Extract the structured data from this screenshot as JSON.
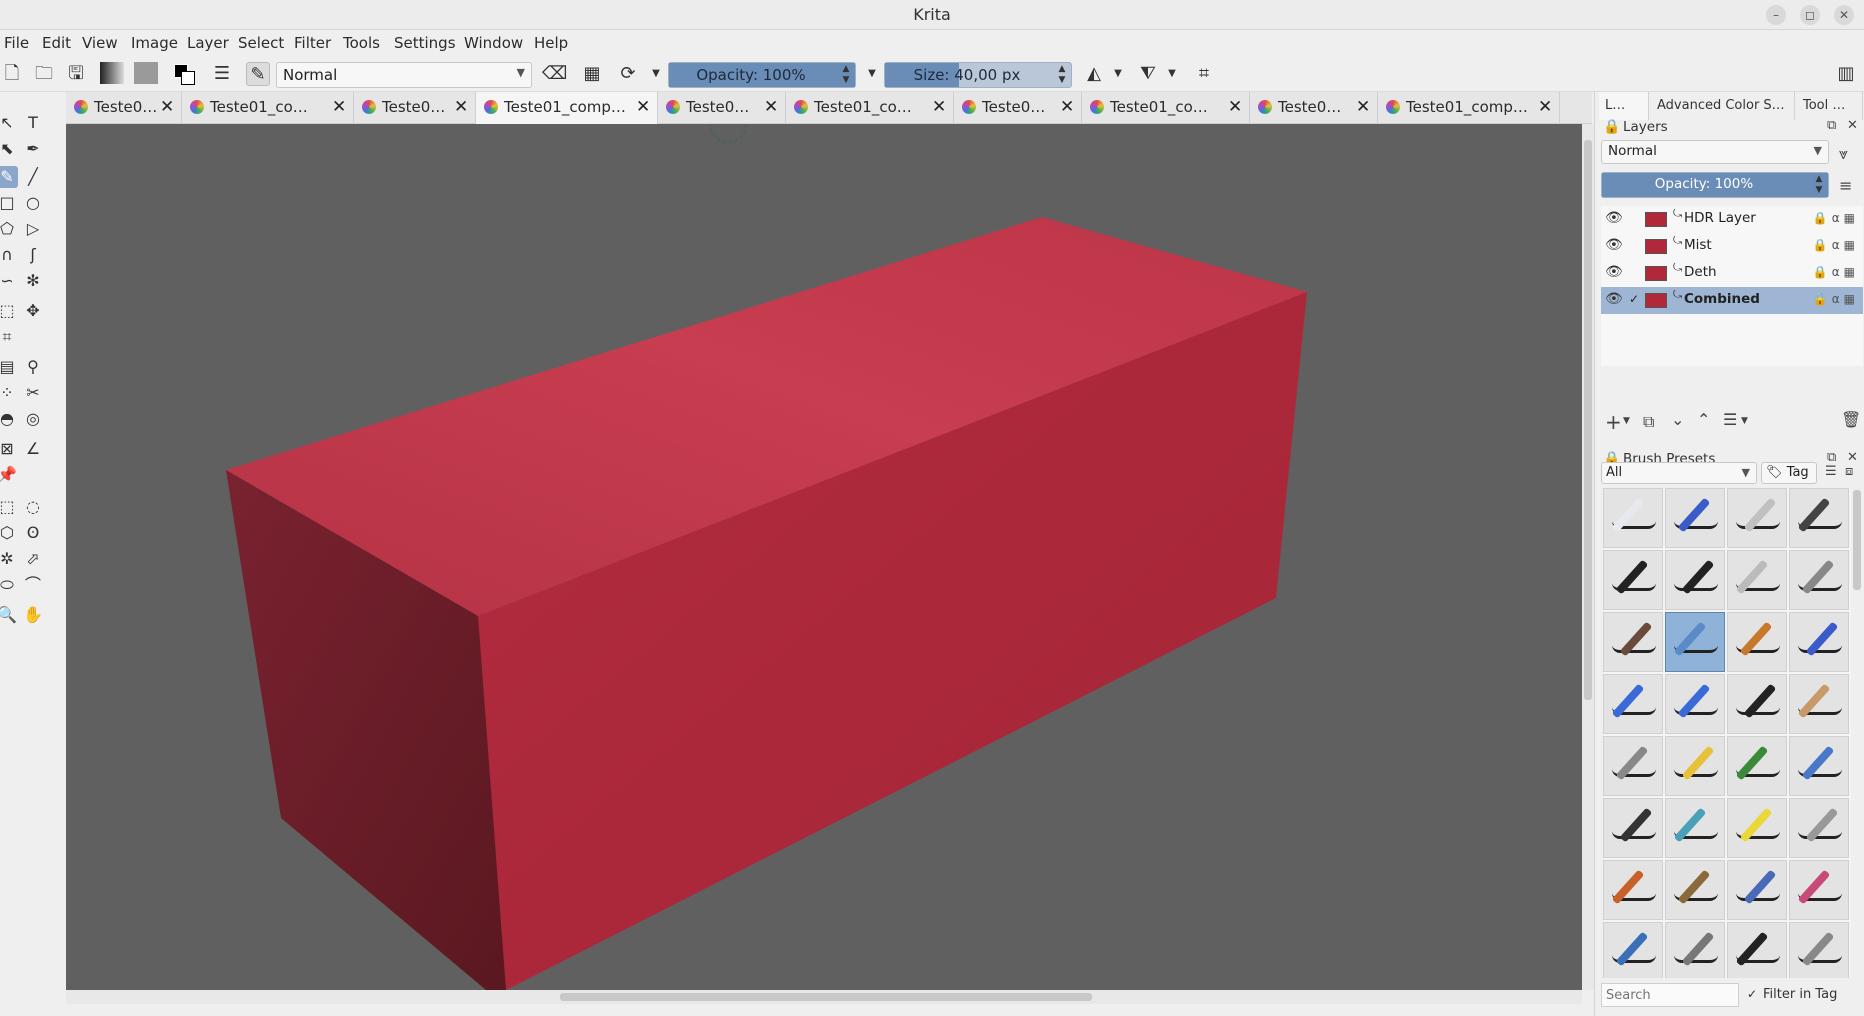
{
  "window": {
    "title": "Krita",
    "minimize": "–",
    "restore": "◻",
    "close": "✕"
  },
  "menu": [
    "File",
    "Edit",
    "View",
    "Image",
    "Layer",
    "Select",
    "Filter",
    "Tools",
    "Settings",
    "Window",
    "Help"
  ],
  "toolbar": {
    "blend_mode": "Normal",
    "opacity_label": "Opacity: 100%",
    "opacity_value": 1.0,
    "size_label": "Size: 40,00 px",
    "size_value": 0.4
  },
  "tabs": [
    {
      "label": "Teste0…",
      "width": 116
    },
    {
      "label": "Teste01_co…",
      "width": 172
    },
    {
      "label": "Teste0…",
      "width": 122
    },
    {
      "label": "Teste01_comp…",
      "width": 182
    },
    {
      "label": "Teste0…",
      "width": 128
    },
    {
      "label": "Teste01_co…",
      "width": 168
    },
    {
      "label": "Teste0…",
      "width": 128
    },
    {
      "label": "Teste01_co…",
      "width": 168
    },
    {
      "label": "Teste0…",
      "width": 128
    },
    {
      "label": "Teste01_comp…",
      "width": 182
    }
  ],
  "active_tab": 3,
  "dock": {
    "tabs": [
      "L…",
      "Advanced Color S…",
      "Tool …"
    ],
    "layers_title": "Layers",
    "layers_blend": "Normal",
    "layers_opacity_label": "Opacity:  100%",
    "layers": [
      {
        "name": "HDR Layer",
        "selected": false,
        "checked": false
      },
      {
        "name": "Mist",
        "selected": false,
        "checked": false
      },
      {
        "name": "Deth",
        "selected": false,
        "checked": false
      },
      {
        "name": "Combined",
        "selected": true,
        "checked": true
      }
    ],
    "brush_title": "Brush Presets",
    "brush_filter": "All",
    "brush_tag": "Tag",
    "search_placeholder": "Search",
    "filter_in_tag": "Filter in Tag"
  },
  "colors": {
    "box_top": "#c43a4c",
    "box_front": "#b02a3d",
    "box_side": "#6e1e28",
    "canvas": "#606060",
    "accent": "#6a8db8"
  }
}
